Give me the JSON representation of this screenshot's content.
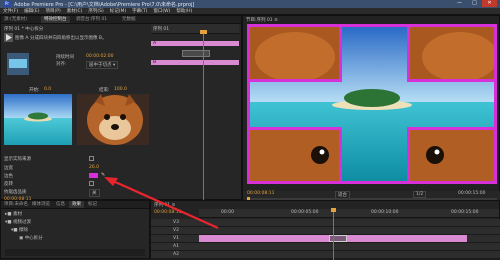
{
  "window": {
    "title": "Adobe Premiere Pro - [C:\\用户\\文档\\Adobe\\Premiere Pro\\7.0\\未命名.prproj]",
    "app_icon_label": "Pr",
    "minimize": "—",
    "maximize": "□",
    "close": "✕"
  },
  "menu": [
    "文件(F)",
    "编辑(E)",
    "项目(P)",
    "素材(C)",
    "序列(S)",
    "标记(M)",
    "字幕(T)",
    "窗口(W)",
    "帮助(H)"
  ],
  "effect_controls": {
    "tabs": [
      "源:(无素材)",
      "特效控制台",
      "调音台:序列 01",
      "元数据"
    ],
    "sequence_label": "序列 01 * 中心拆分",
    "description": "图像 A 分成四块并向四角移出以显示图像 B。",
    "duration_label": "持续时间",
    "duration_value": "00:00:02:00",
    "alignment_label": "对齐:",
    "alignment_value": "居中于切点",
    "start_label": "开始:",
    "start_value": "0.0",
    "end_label": "结束:",
    "end_value": "100.0",
    "show_source_label": "显示实际来源",
    "border_width_label": "边宽",
    "border_width_value": "26.0",
    "border_color_label": "边色",
    "border_color": "#d830d8",
    "reverse_label": "反转",
    "antialias_label": "抗锯齿品质",
    "antialias_value": "关",
    "timecode": "00:00:08:11",
    "mini_timeline_label": "序列 01",
    "clip_a_label": "A",
    "clip_b_label": "B"
  },
  "program_monitor": {
    "title": "节目:序列 01 ≡",
    "timecode_current": "00:00:08:11",
    "fit_label": "适合",
    "quality_label": "1/2",
    "timecode_duration": "00:00:15:00"
  },
  "project": {
    "tabs": [
      "项目:未命名",
      "媒体浏览",
      "信息",
      "效果",
      "标记"
    ],
    "items": [
      "素材",
      "视频过渡",
      "擦除",
      "中心拆分"
    ]
  },
  "timeline": {
    "title": "序列 01 ≡",
    "timecode": "00:00:08:11",
    "ruler_ticks": [
      "00:00",
      "00:00:05:00",
      "00:00:10:00",
      "00:00:15:00"
    ],
    "tracks": [
      "V3",
      "V2",
      "V1",
      "A1",
      "A2"
    ],
    "transition_label": "中心拆分"
  },
  "colors": {
    "accent": "#e3a23a",
    "playhead": "#e24a4a",
    "clip_pink": "#d98ad0",
    "border_magenta": "#d830d8",
    "arrow_red": "#e8252f"
  }
}
